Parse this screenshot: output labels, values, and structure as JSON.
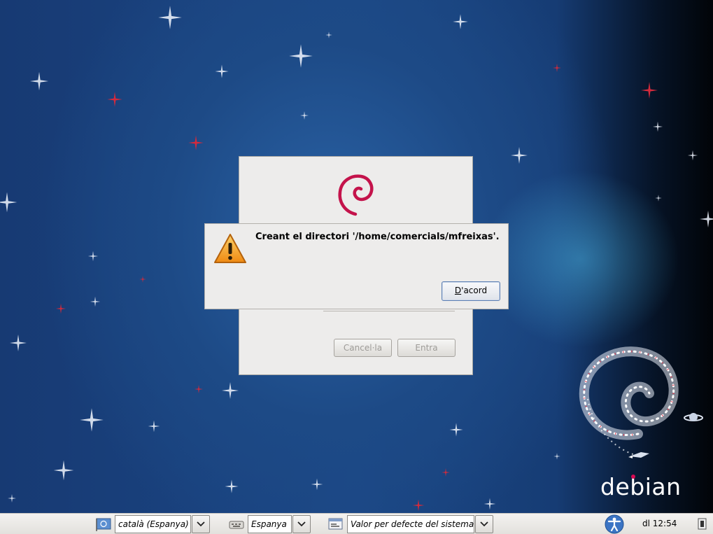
{
  "desktop": {
    "brand_text": "debian"
  },
  "login_window": {
    "cancel_label": "Cancel·la",
    "enter_label": "Entra"
  },
  "message_dialog": {
    "message": "Creant el directori '/home/comercials/mfreixas'.",
    "ok_label_accel": "D",
    "ok_label_rest": "'acord"
  },
  "panel": {
    "language_value": "català (Espanya)",
    "keyboard_value": "Espanya",
    "session_value": "Valor per defecte del sistema",
    "clock": "dl 12:54"
  },
  "colors": {
    "debian_red": "#d70a53",
    "warning_orange": "#f0a020",
    "focus_blue": "#5c7fb3"
  },
  "icons": [
    "language-flag-icon",
    "keyboard-icon",
    "session-icon",
    "accessibility-icon",
    "shutdown-icon",
    "warning-icon",
    "debian-swirl-icon"
  ]
}
